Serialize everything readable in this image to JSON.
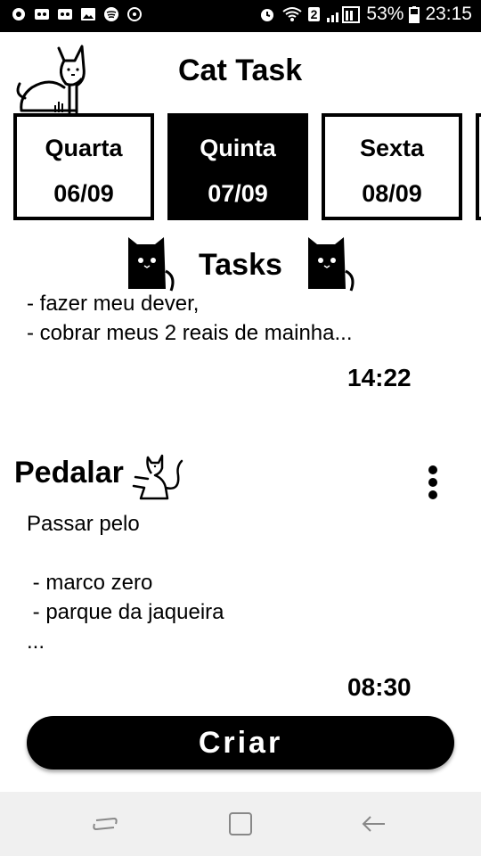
{
  "status_bar": {
    "battery": "53%",
    "time": "23:15",
    "sim_badge": "2",
    "left_icons": [
      "chat-icon",
      "voicemail-icon",
      "voicemail-icon",
      "image-icon",
      "spotify-icon",
      "sync-icon"
    ],
    "right_icons": [
      "alarm-icon",
      "wifi-icon",
      "signal-icon",
      "battery-icon"
    ]
  },
  "app": {
    "title": "Cat Task"
  },
  "days": [
    {
      "name": "Quarta",
      "date": "06/09",
      "selected": false
    },
    {
      "name": "Quinta",
      "date": "07/09",
      "selected": true
    },
    {
      "name": "Sexta",
      "date": "08/09",
      "selected": false
    }
  ],
  "tasks_header": {
    "title": "Tasks"
  },
  "tasks": [
    {
      "body": "- fazer meu dever,\n- cobrar meus 2 reais de mainha...",
      "time": "14:22"
    },
    {
      "title": "Pedalar",
      "body": "Passar pelo\n\n - marco zero\n - parque da jaqueira\n...",
      "time": "08:30"
    }
  ],
  "create_button": {
    "label": "Criar"
  },
  "nav": {
    "icons": [
      "recent-apps-icon",
      "home-icon",
      "back-icon"
    ]
  },
  "colors": {
    "primary": "#000000",
    "background": "#ffffff",
    "navbar": "#f0f0f0"
  }
}
